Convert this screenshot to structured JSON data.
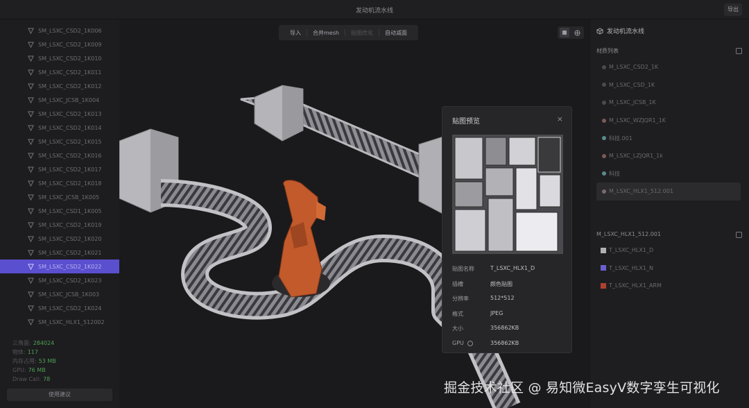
{
  "app": {
    "title": "发动机流水线",
    "export_label": "导出"
  },
  "left_panel": {
    "meshes": [
      "SM_LSXC_CSD2_1K006",
      "SM_LSXC_CSD2_1K009",
      "SM_LSXC_CSD2_1K010",
      "SM_LSXC_CSD2_1K011",
      "SM_LSXC_CSD2_1K012",
      "SM_LSXC_JCSB_1K004",
      "SM_LSXC_CSD2_1K013",
      "SM_LSXC_CSD2_1K014",
      "SM_LSXC_CSD2_1K015",
      "SM_LSXC_CSD2_1K016",
      "SM_LSXC_CSD2_1K017",
      "SM_LSXC_CSD2_1K018",
      "SM_LSXC_JCSB_1K005",
      "SM_LSXC_CSD1_1K005",
      "SM_LSXC_CSD2_1K019",
      "SM_LSXC_CSD2_1K020",
      "SM_LSXC_CSD2_1K021",
      "SM_LSXC_CSD2_1K022",
      "SM_LSXC_CSD2_1K023",
      "SM_LSXC_JCSB_1K003",
      "SM_LSXC_CSD2_1K024",
      "SM_LSXC_HLX1_512002"
    ],
    "selected_index": 17,
    "stats": [
      {
        "label": "三角面:",
        "value": "284024"
      },
      {
        "label": "物体:",
        "value": "117"
      },
      {
        "label": "内存占用:",
        "value": "53 MB"
      },
      {
        "label": "GPU:",
        "value": "76 MB"
      },
      {
        "label": "Draw Call:",
        "value": "78"
      }
    ],
    "suggest_label": "使用建议"
  },
  "toolbar": {
    "import_label": "导入",
    "merge_label": "合并mesh",
    "texture_opt_label": "贴图优化",
    "auto_reduce_label": "自动减面"
  },
  "preview": {
    "title": "贴图预览",
    "close": "×",
    "rows": [
      {
        "key": "贴图名称",
        "value": "T_LSXC_HLX1_D"
      },
      {
        "key": "插槽",
        "value": "颜色贴图"
      },
      {
        "key": "分辨率",
        "value": "512*512"
      },
      {
        "key": "格式",
        "value": "JPEG"
      },
      {
        "key": "大小",
        "value": "356862KB"
      },
      {
        "key": "GPU",
        "value": "356862KB"
      }
    ]
  },
  "right_panel": {
    "title": "发动机流水线",
    "material_section": "材质列表",
    "materials": [
      {
        "name": "M_LSXC_CSD2_1K",
        "color": "#4a4a4e"
      },
      {
        "name": "M_LSXC_CSD_1K",
        "color": "#4a4a4e"
      },
      {
        "name": "M_LSXC_JCSB_1K",
        "color": "#4a4a4e"
      },
      {
        "name": "M_LSXC_WZJQR1_1K",
        "color": "#7a5a55"
      },
      {
        "name": "科技.001",
        "color": "#5a8a8e"
      },
      {
        "name": "M_LSXC_LZJQR1_1k",
        "color": "#7a5a55"
      },
      {
        "name": "科技",
        "color": "#5a8a8e"
      },
      {
        "name": "M_LSXC_HLX1_512.001",
        "color": "#7a6a6a"
      }
    ],
    "selected_material_index": 7,
    "texture_section": "M_LSXC_HLX1_512.001",
    "textures": [
      {
        "name": "T_LSXC_HLX1_D",
        "color": "#b0b0b4"
      },
      {
        "name": "T_LSXC_HLX1_N",
        "color": "#6a5fd0"
      },
      {
        "name": "T_LSXC_HLX1_ARM",
        "color": "#b04030"
      }
    ]
  },
  "watermark": "掘金技术社区 @ 易知微EasyV数字孪生可视化"
}
